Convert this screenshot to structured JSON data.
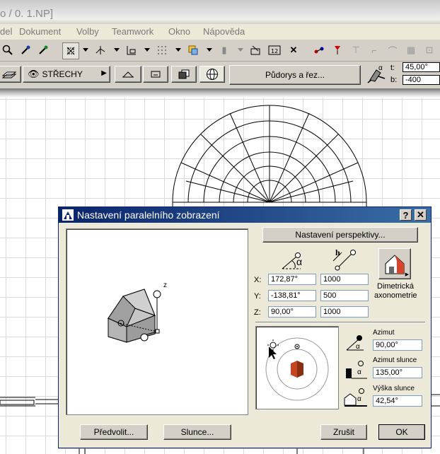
{
  "app": {
    "title": "o / 0. 1.NP]"
  },
  "menu": [
    "del",
    "Dokument",
    "Volby",
    "Teamwork",
    "Okno",
    "Nápověda"
  ],
  "toolbar2": {
    "layer_label": "STŘECHY",
    "plan_button": "Půdorys a řez...",
    "angle_label": "t:",
    "angle_value": "45,00°",
    "b_label": "b:",
    "b_value": "-400"
  },
  "dialog": {
    "title": "Nastavení paralelního zobrazení",
    "help": "?",
    "close": "✕",
    "perspective_button": "Nastavení perspektivy...",
    "axis_label": "z",
    "alpha_symbol": "α",
    "h_symbol": "h",
    "coords": [
      {
        "label": "X:",
        "angle": "172,87°",
        "dist": "1000"
      },
      {
        "label": "Y:",
        "angle": "-138,81°",
        "dist": "500"
      },
      {
        "label": "Z:",
        "angle": "90,00°",
        "dist": "1000"
      }
    ],
    "projection_type": [
      "Dimetrická",
      "axonometrie"
    ],
    "azimuth_label": "Azimut",
    "azimuth_value": "90,00°",
    "sun_azimuth_label": "Azimut slunce",
    "sun_azimuth_value": "135,00°",
    "sun_height_label": "Výška slunce",
    "sun_height_value": "42,54°",
    "preset_button": "Předvolit...",
    "sun_button": "Slunce...",
    "cancel_button": "Zrušit",
    "ok_button": "OK"
  }
}
